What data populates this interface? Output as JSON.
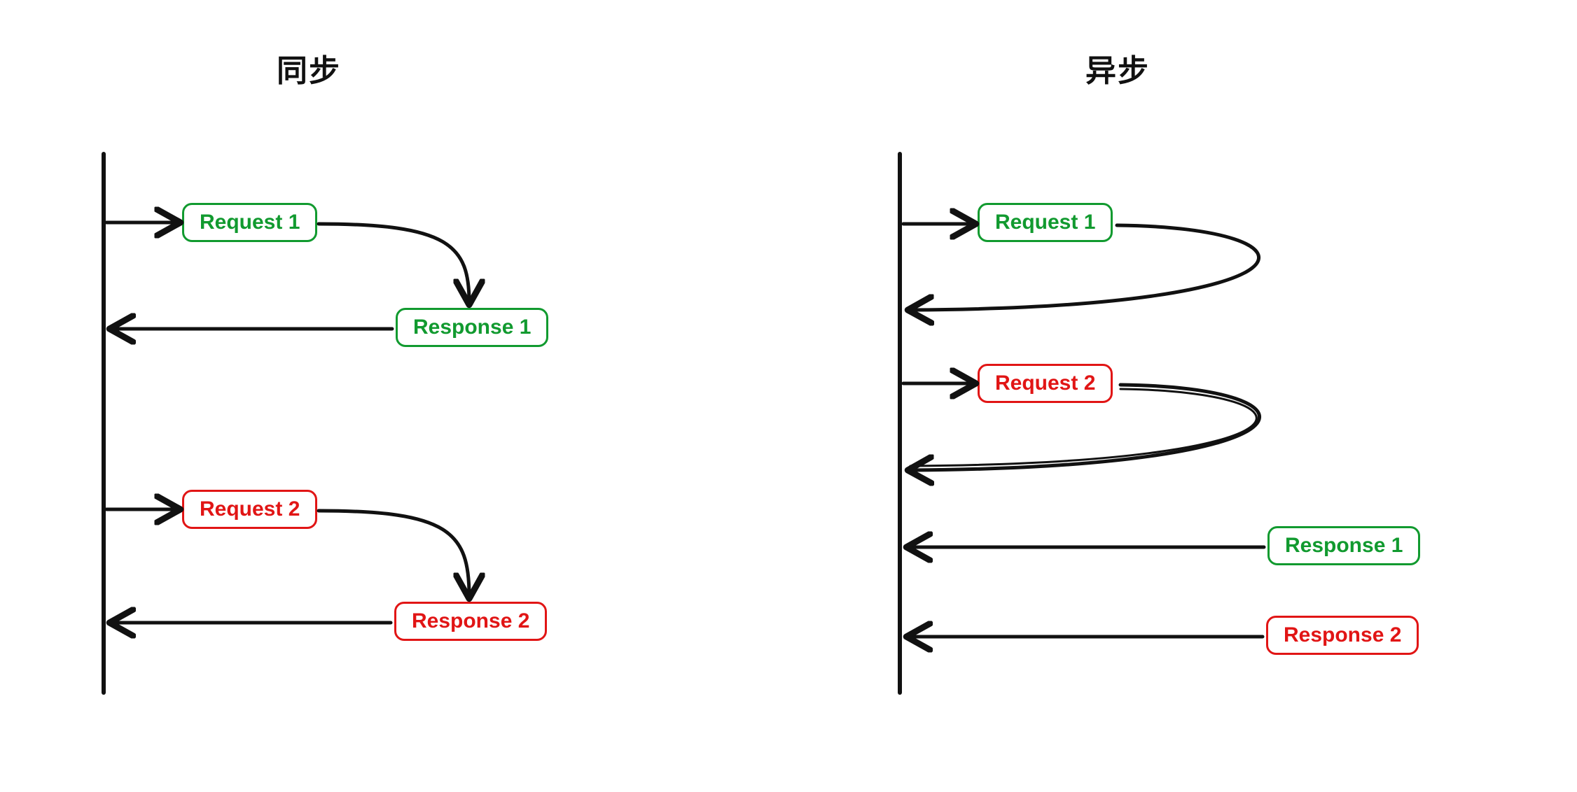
{
  "colors": {
    "green": "#119a2f",
    "red": "#e11515",
    "ink": "#111111"
  },
  "left": {
    "title": "同步",
    "req1": "Request 1",
    "resp1": "Response 1",
    "req2": "Request 2",
    "resp2": "Response 2"
  },
  "right": {
    "title": "异步",
    "req1": "Request 1",
    "req2": "Request 2",
    "resp1": "Response 1",
    "resp2": "Response 2"
  }
}
